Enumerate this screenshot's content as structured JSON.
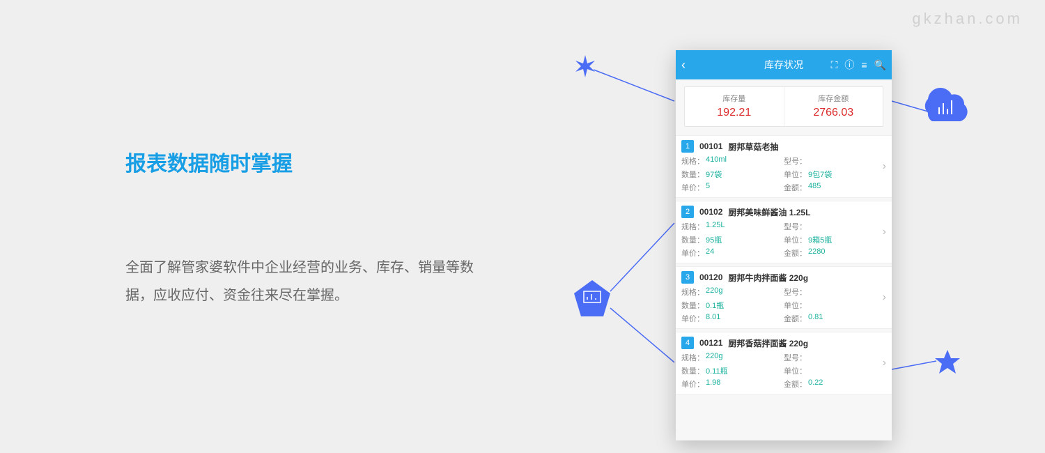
{
  "watermark": "gkzhan.com",
  "marketing": {
    "title": "报表数据随时掌握",
    "body": "全面了解管家婆软件中企业经营的业务、库存、销量等数据，应收应付、资金往来尽在掌握。"
  },
  "app": {
    "header": {
      "title": "库存状况"
    },
    "summary": {
      "qty_label": "库存量",
      "qty_value": "192.21",
      "amt_label": "库存金额",
      "amt_value": "2766.03"
    },
    "labels": {
      "spec": "规格：",
      "model": "型号：",
      "qty": "数量：",
      "unit": "单位：",
      "price": "单价：",
      "amt": "金额："
    },
    "items": [
      {
        "idx": "1",
        "code": "00101",
        "name": "厨邦草菇老抽",
        "spec": "410ml",
        "model": "",
        "qty": "97袋",
        "unit": "9包7袋",
        "price": "5",
        "amt": "485"
      },
      {
        "idx": "2",
        "code": "00102",
        "name": "厨邦美味鲜酱油 1.25L",
        "spec": "1.25L",
        "model": "",
        "qty": "95瓶",
        "unit": "9箱5瓶",
        "price": "24",
        "amt": "2280"
      },
      {
        "idx": "3",
        "code": "00120",
        "name": "厨邦牛肉拌面酱 220g",
        "spec": "220g",
        "model": "",
        "qty": "0.1瓶",
        "unit": "",
        "price": "8.01",
        "amt": "0.81"
      },
      {
        "idx": "4",
        "code": "00121",
        "name": "厨邦香菇拌面酱 220g",
        "spec": "220g",
        "model": "",
        "qty": "0.11瓶",
        "unit": "",
        "price": "1.98",
        "amt": "0.22"
      }
    ]
  }
}
